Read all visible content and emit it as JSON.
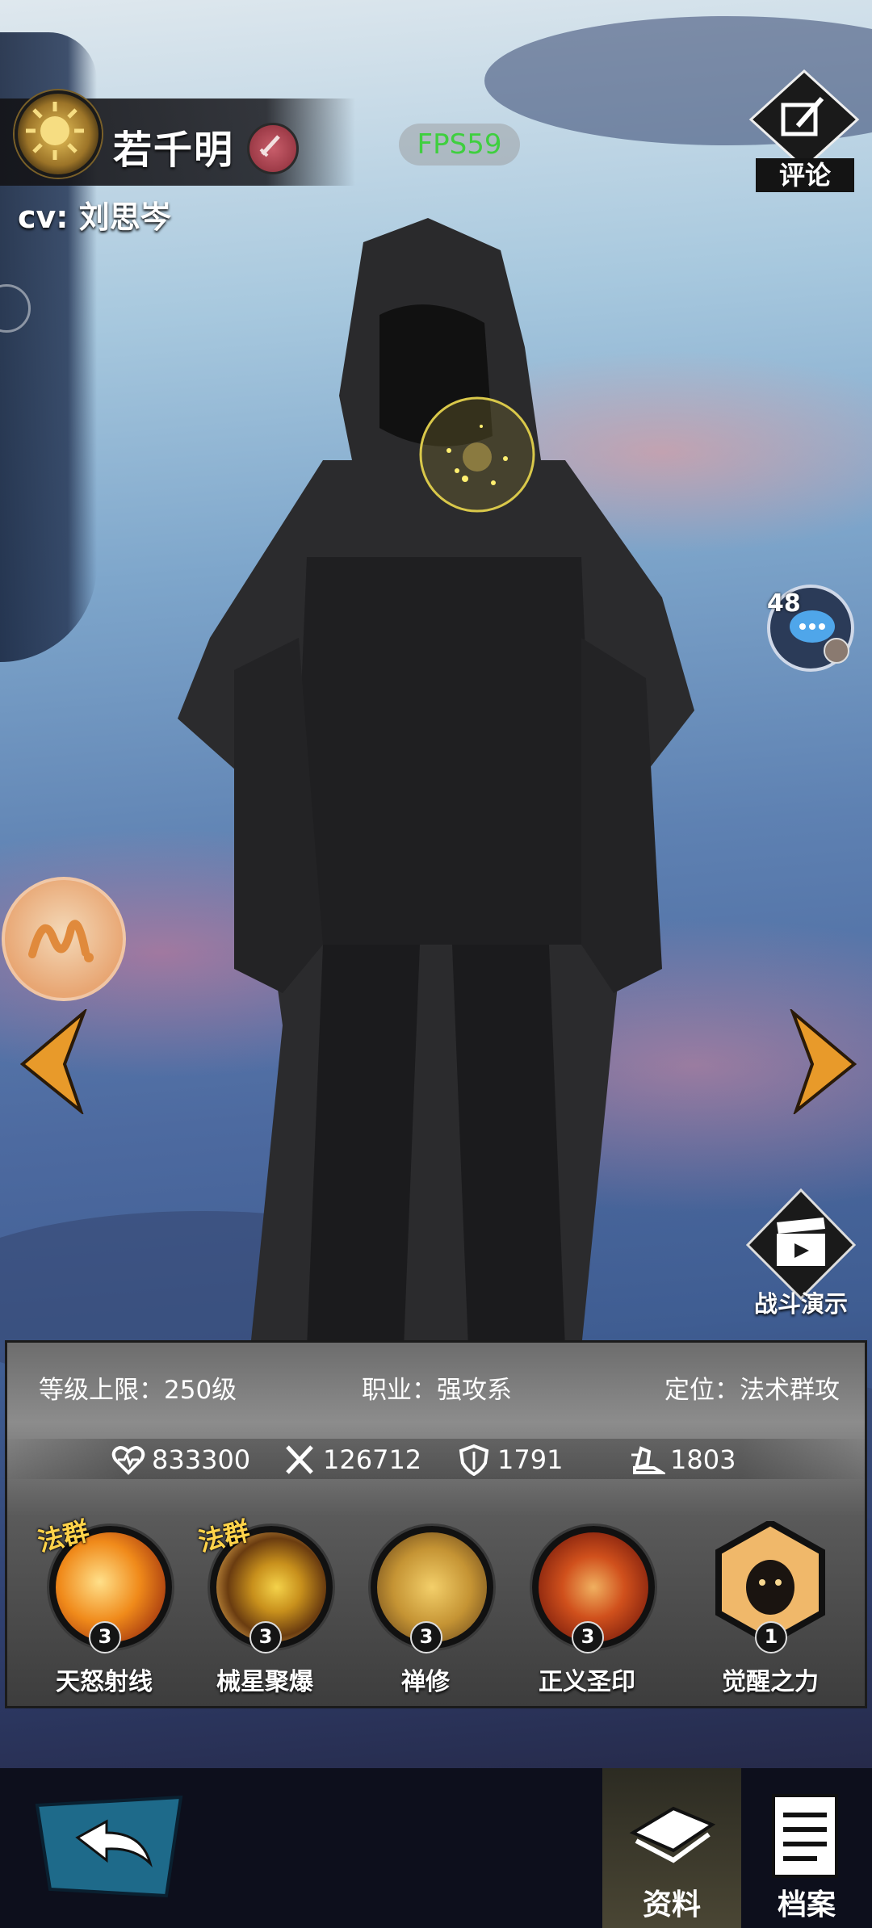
{
  "hero": {
    "name": "若千明",
    "cv": "cv: 刘思岑"
  },
  "overlay": {
    "fps": "FPS59",
    "comment_label": "评论",
    "chat_count": "48",
    "battle_demo_label": "战斗演示"
  },
  "info": {
    "level_cap": "等级上限：250级",
    "profession": "职业：强攻系",
    "role": "定位：法术群攻"
  },
  "stats": {
    "hp": "833300",
    "attack": "126712",
    "defense": "1791",
    "speed": "1803"
  },
  "skills": [
    {
      "name": "天怒射线",
      "level": "3",
      "tag": "法群"
    },
    {
      "name": "械星聚爆",
      "level": "3",
      "tag": "法群"
    },
    {
      "name": "禅修",
      "level": "3",
      "tag": ""
    },
    {
      "name": "正义圣印",
      "level": "3",
      "tag": ""
    },
    {
      "name": "觉醒之力",
      "level": "1",
      "tag": ""
    }
  ],
  "tabs": {
    "data": "资料",
    "archive": "档案"
  },
  "colors": {
    "fps_green": "#3fcf3f",
    "skill_tag": "#ffd34a",
    "bottom_bar": "#0d0f1c"
  }
}
